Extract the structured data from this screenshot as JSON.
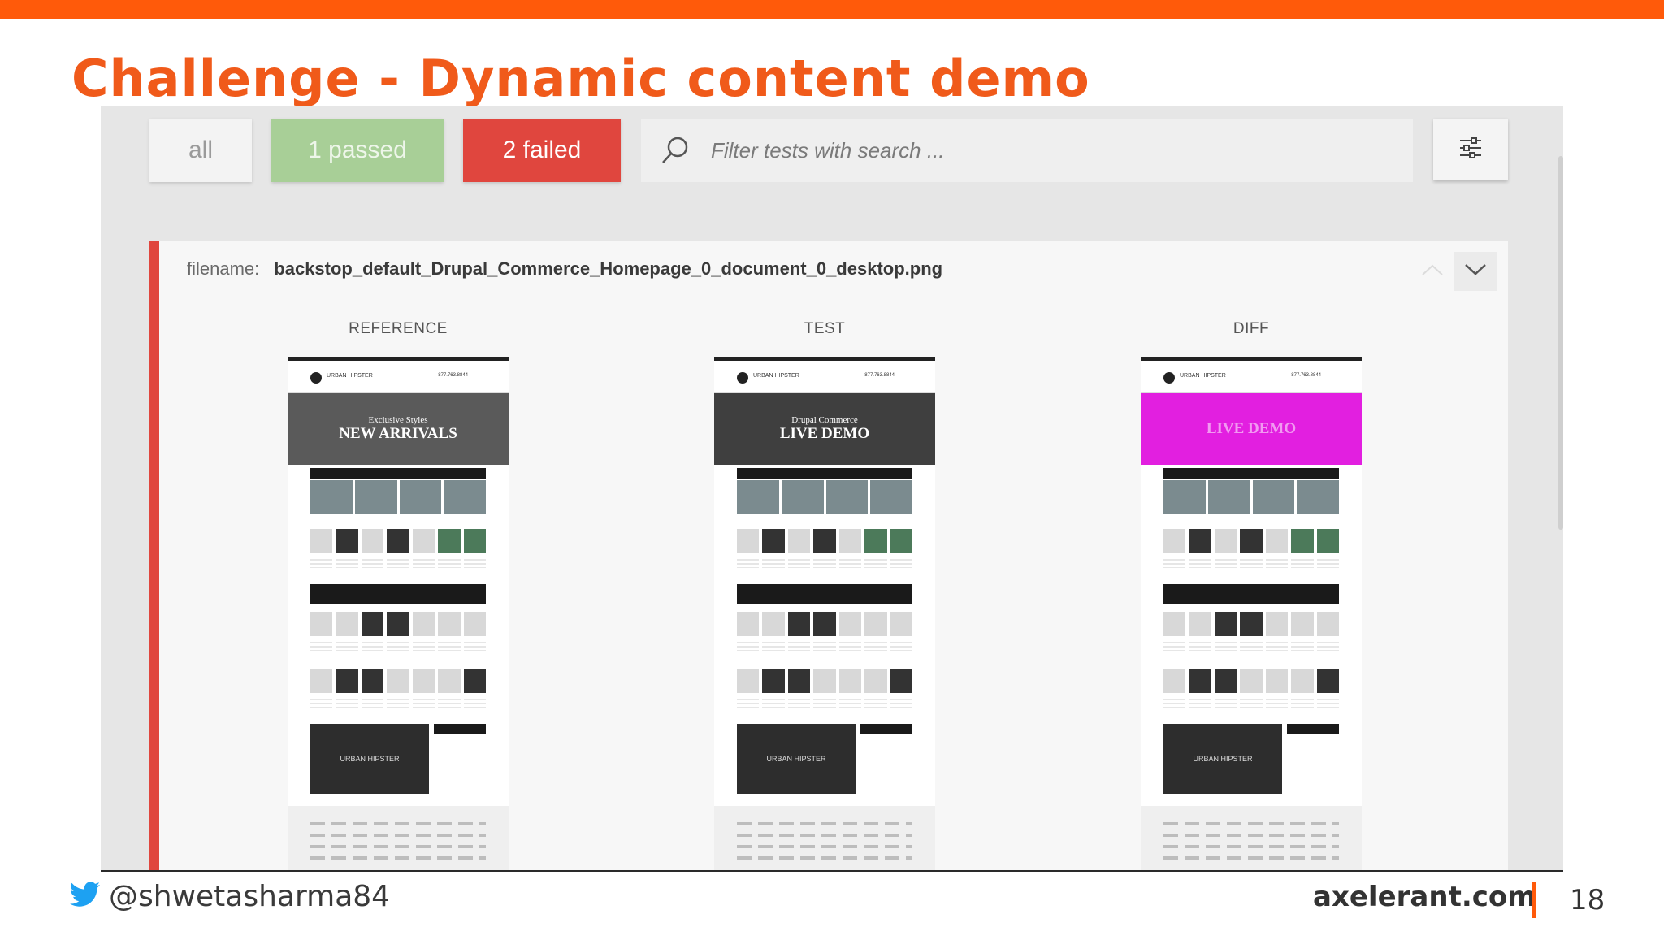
{
  "slide": {
    "title": "Challenge - Dynamic content demo",
    "handle": "@shwetasharma84",
    "site": "axelerant.com",
    "page_number": "18",
    "accent_color": "#ff5a0a"
  },
  "filters": {
    "all_label": "all",
    "passed_label": "1 passed",
    "failed_label": "2 failed",
    "search_placeholder": "Filter tests with search ..."
  },
  "test_card": {
    "filename_label": "filename:",
    "filename_value": "backstop_default_Drupal_Commerce_Homepage_0_document_0_desktop.png",
    "columns": [
      {
        "label": "REFERENCE",
        "hero_sub": "Exclusive Styles",
        "hero_main": "NEW ARRIVALS"
      },
      {
        "label": "TEST",
        "hero_sub": "Drupal Commerce",
        "hero_main": "LIVE DEMO"
      },
      {
        "label": "DIFF",
        "hero_sub": "",
        "hero_main": "LIVE DEMO"
      }
    ],
    "thumb_logo_text": "URBAN HIPSTER",
    "thumb_phone": "877.763.8844",
    "thumb_promo_text": "URBAN HIPSTER"
  },
  "colors": {
    "passed": "#a8cf97",
    "failed": "#e0463e",
    "diff_highlight": "#e21fe0"
  }
}
